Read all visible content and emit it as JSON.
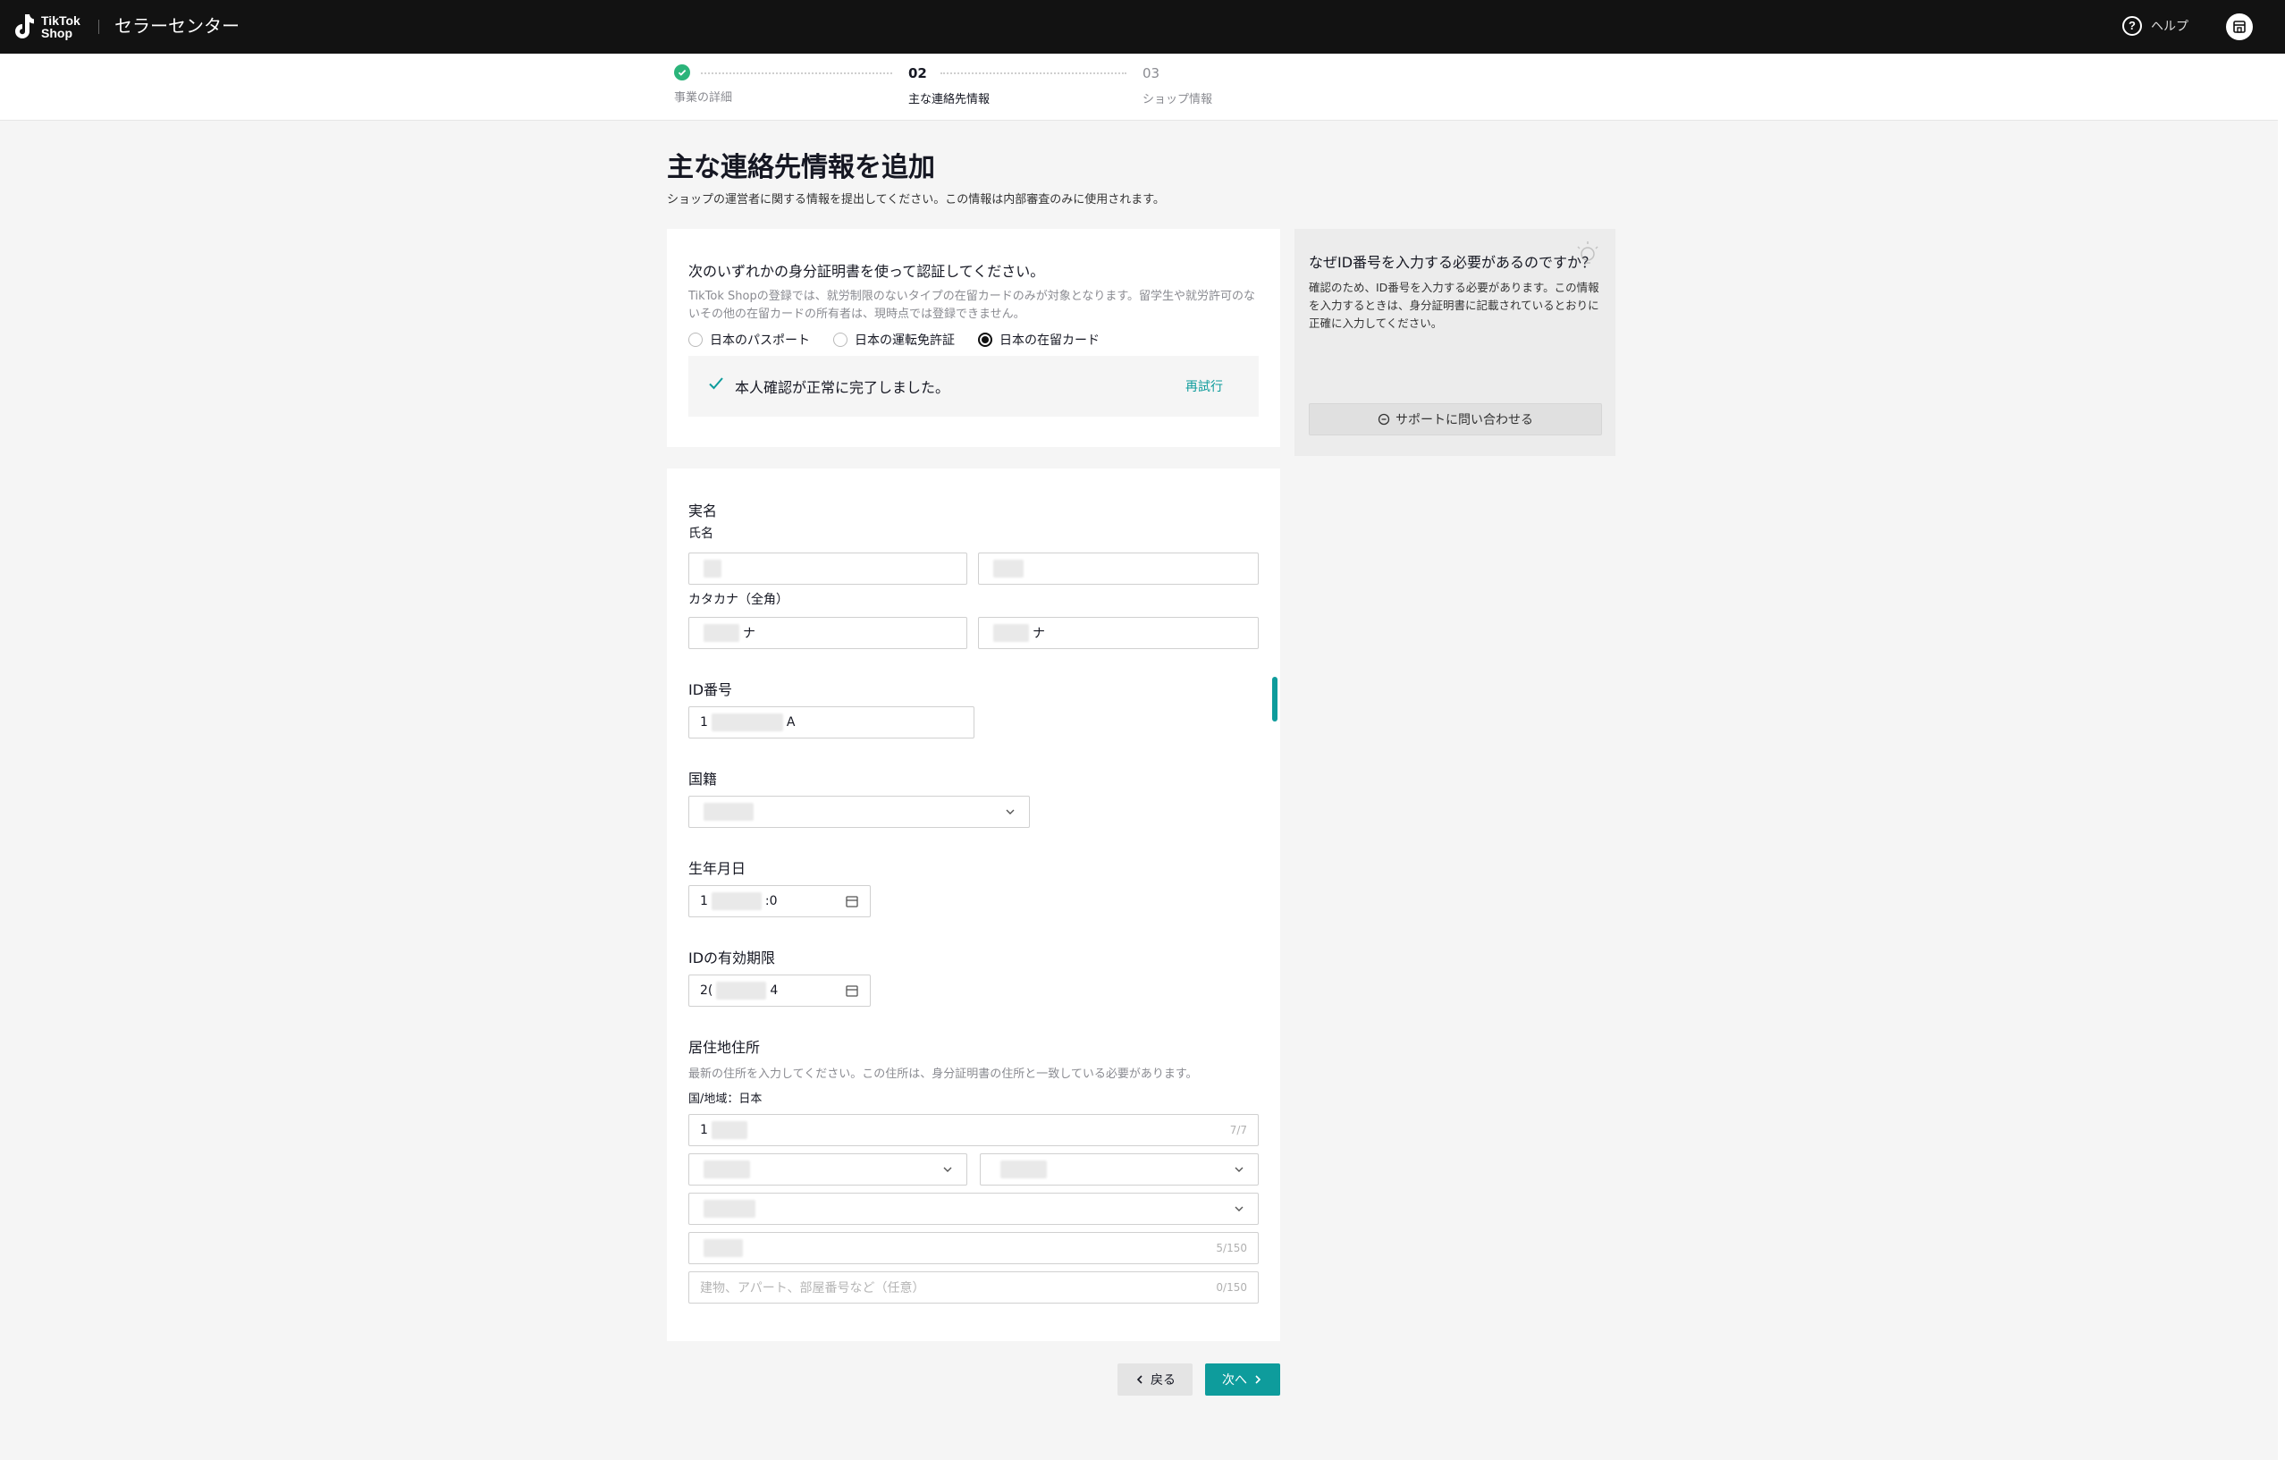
{
  "topbar": {
    "logo_line1": "TikTok",
    "logo_line2": "Shop",
    "app_title": "セラーセンター",
    "help_label": "ヘルプ",
    "help_icon_glyph": "?"
  },
  "stepper": {
    "steps": [
      {
        "num": "",
        "label": "事業の詳細",
        "status": "done"
      },
      {
        "num": "02",
        "label": "主な連絡先情報",
        "status": "active"
      },
      {
        "num": "03",
        "label": "ショップ情報",
        "status": "upcoming"
      }
    ]
  },
  "page": {
    "title": "主な連絡先情報を追加",
    "subtitle": "ショップの運営者に関する情報を提出してください。この情報は内部審査のみに使用されます。"
  },
  "id_card": {
    "title": "次のいずれかの身分証明書を使って認証してください。",
    "description": "TikTok Shopの登録では、就労制限のないタイプの在留カードのみが対象となります。留学生や就労許可のないその他の在留カードの所有者は、現時点では登録できません。",
    "options": [
      "日本のパスポート",
      "日本の運転免許証",
      "日本の在留カード"
    ],
    "selected_index": 2,
    "verified_text": "本人確認が正常に完了しました。",
    "retry_label": "再試行"
  },
  "sidebar": {
    "title": "なぜID番号を入力する必要があるのですか？",
    "description": "確認のため、ID番号を入力する必要があります。この情報を入力するときは、身分証明書に記載されているとおりに正確に入力してください。",
    "support_label": "サポートに問い合わせる"
  },
  "form": {
    "real_name_label": "実名",
    "full_name_label": "氏名",
    "katakana_label": "カタカナ（全角）",
    "katakana_suffix_last": "ナ",
    "katakana_suffix_first": "ナ",
    "id_number_label": "ID番号",
    "id_number_prefix": "1",
    "id_number_suffix": "A",
    "nationality_label": "国籍",
    "birth_label": "生年月日",
    "birth_prefix": "1",
    "birth_suffix": ":0",
    "expiry_label": "IDの有効期限",
    "expiry_prefix": "2(",
    "expiry_suffix": "4",
    "address_label": "居住地住所",
    "address_help": "最新の住所を入力してください。この住所は、身分証明書の住所と一致している必要があります。",
    "country_label": "国/地域：日本",
    "postal_prefix": "1",
    "postal_counter": "7/7",
    "street_counter": "5/150",
    "building_placeholder": "建物、アパート、部屋番号など（任意）",
    "building_counter": "0/150"
  },
  "footer": {
    "back_label": "戻る",
    "next_label": "次へ"
  },
  "colors": {
    "accent": "#0e9c9c",
    "success": "#2bb47a",
    "topbar": "#121212"
  }
}
